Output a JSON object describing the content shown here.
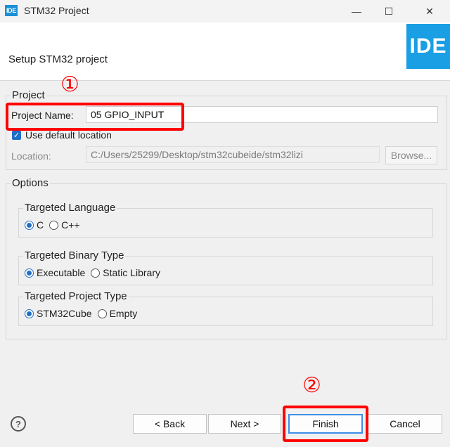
{
  "window": {
    "app_icon_text": "IDE",
    "title": "STM32 Project",
    "minimize_glyph": "—",
    "maximize_glyph": "☐",
    "close_glyph": "✕"
  },
  "header": {
    "title": "Setup STM32 project",
    "logo_text": "IDE"
  },
  "project": {
    "group_label": "Project",
    "name_label": "Project Name:",
    "name_value": "05 GPIO_INPUT",
    "use_default_label": "Use default location",
    "use_default_checked": true,
    "location_label": "Location:",
    "location_value": "C:/Users/25299/Desktop/stm32cubeide/stm32lizi",
    "browse_label": "Browse..."
  },
  "options": {
    "group_label": "Options",
    "language": {
      "label": "Targeted Language",
      "opt1": "C",
      "opt2": "C++"
    },
    "binary": {
      "label": "Targeted Binary Type",
      "opt1": "Executable",
      "opt2": "Static Library"
    },
    "project_type": {
      "label": "Targeted Project Type",
      "opt1": "STM32Cube",
      "opt2": "Empty"
    }
  },
  "footer": {
    "help_glyph": "?",
    "back_label": "< Back",
    "next_label": "Next >",
    "finish_label": "Finish",
    "cancel_label": "Cancel"
  },
  "annotations": {
    "marker1": "①",
    "marker2": "②",
    "color": "#ff0000"
  },
  "colors": {
    "accent": "#1e6fc9",
    "logo_bg": "#1a9ee4"
  }
}
